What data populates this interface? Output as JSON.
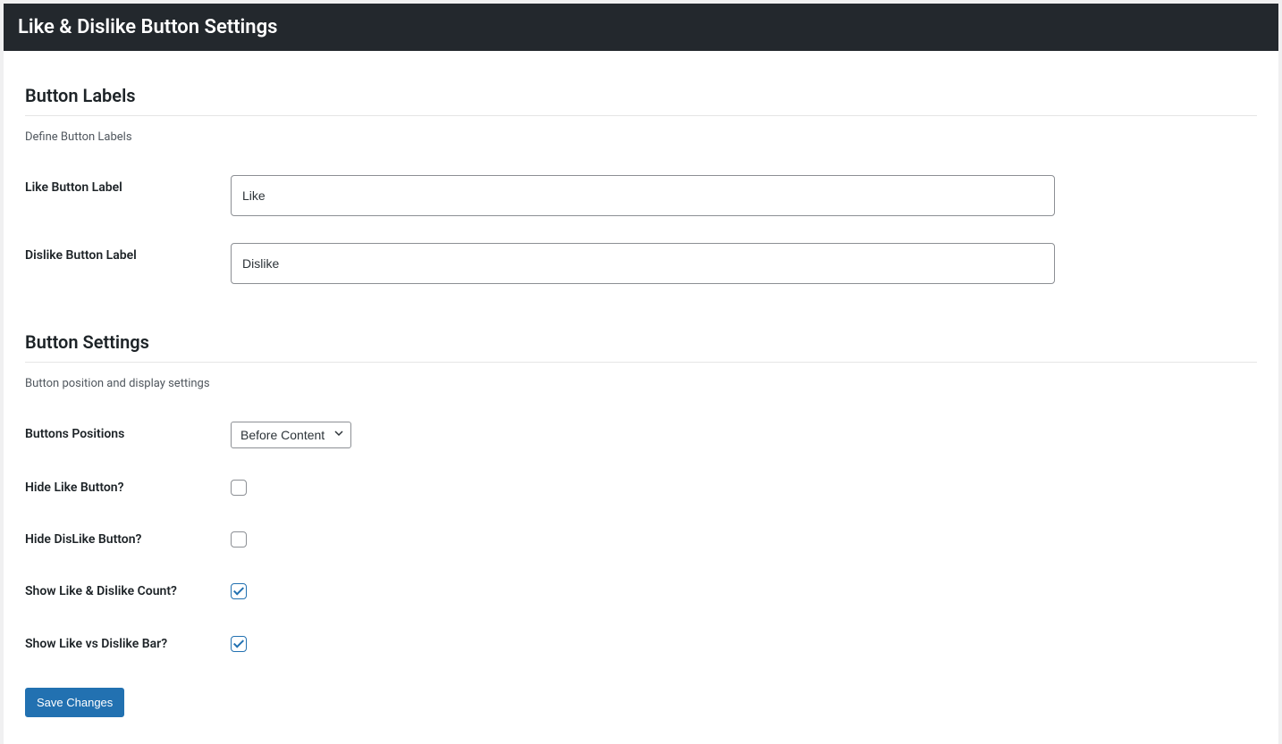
{
  "header": {
    "title": "Like & Dislike Button Settings"
  },
  "sections": {
    "labels": {
      "title": "Button Labels",
      "desc": "Define Button Labels",
      "fields": {
        "like_label": {
          "label": "Like Button Label",
          "value": "Like"
        },
        "dislike_label": {
          "label": "Dislike Button Label",
          "value": "Dislike"
        }
      }
    },
    "settings": {
      "title": "Button Settings",
      "desc": "Button position and display settings",
      "fields": {
        "position": {
          "label": "Buttons Positions",
          "selected": "Before Content"
        },
        "hide_like": {
          "label": "Hide Like Button?",
          "checked": false
        },
        "hide_dislike": {
          "label": "Hide DisLike Button?",
          "checked": false
        },
        "show_count": {
          "label": "Show Like & Dislike Count?",
          "checked": true
        },
        "show_bar": {
          "label": "Show Like vs Dislike Bar?",
          "checked": true
        }
      }
    }
  },
  "actions": {
    "save": "Save Changes"
  }
}
